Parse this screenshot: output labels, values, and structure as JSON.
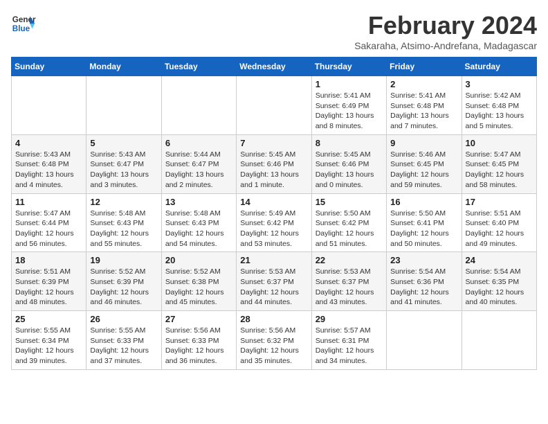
{
  "logo": {
    "line1": "General",
    "line2": "Blue"
  },
  "title": "February 2024",
  "subtitle": "Sakaraha, Atsimo-Andrefana, Madagascar",
  "days_of_week": [
    "Sunday",
    "Monday",
    "Tuesday",
    "Wednesday",
    "Thursday",
    "Friday",
    "Saturday"
  ],
  "weeks": [
    [
      {
        "day": "",
        "info": ""
      },
      {
        "day": "",
        "info": ""
      },
      {
        "day": "",
        "info": ""
      },
      {
        "day": "",
        "info": ""
      },
      {
        "day": "1",
        "info": "Sunrise: 5:41 AM\nSunset: 6:49 PM\nDaylight: 13 hours\nand 8 minutes."
      },
      {
        "day": "2",
        "info": "Sunrise: 5:41 AM\nSunset: 6:48 PM\nDaylight: 13 hours\nand 7 minutes."
      },
      {
        "day": "3",
        "info": "Sunrise: 5:42 AM\nSunset: 6:48 PM\nDaylight: 13 hours\nand 5 minutes."
      }
    ],
    [
      {
        "day": "4",
        "info": "Sunrise: 5:43 AM\nSunset: 6:48 PM\nDaylight: 13 hours\nand 4 minutes."
      },
      {
        "day": "5",
        "info": "Sunrise: 5:43 AM\nSunset: 6:47 PM\nDaylight: 13 hours\nand 3 minutes."
      },
      {
        "day": "6",
        "info": "Sunrise: 5:44 AM\nSunset: 6:47 PM\nDaylight: 13 hours\nand 2 minutes."
      },
      {
        "day": "7",
        "info": "Sunrise: 5:45 AM\nSunset: 6:46 PM\nDaylight: 13 hours\nand 1 minute."
      },
      {
        "day": "8",
        "info": "Sunrise: 5:45 AM\nSunset: 6:46 PM\nDaylight: 13 hours\nand 0 minutes."
      },
      {
        "day": "9",
        "info": "Sunrise: 5:46 AM\nSunset: 6:45 PM\nDaylight: 12 hours\nand 59 minutes."
      },
      {
        "day": "10",
        "info": "Sunrise: 5:47 AM\nSunset: 6:45 PM\nDaylight: 12 hours\nand 58 minutes."
      }
    ],
    [
      {
        "day": "11",
        "info": "Sunrise: 5:47 AM\nSunset: 6:44 PM\nDaylight: 12 hours\nand 56 minutes."
      },
      {
        "day": "12",
        "info": "Sunrise: 5:48 AM\nSunset: 6:43 PM\nDaylight: 12 hours\nand 55 minutes."
      },
      {
        "day": "13",
        "info": "Sunrise: 5:48 AM\nSunset: 6:43 PM\nDaylight: 12 hours\nand 54 minutes."
      },
      {
        "day": "14",
        "info": "Sunrise: 5:49 AM\nSunset: 6:42 PM\nDaylight: 12 hours\nand 53 minutes."
      },
      {
        "day": "15",
        "info": "Sunrise: 5:50 AM\nSunset: 6:42 PM\nDaylight: 12 hours\nand 51 minutes."
      },
      {
        "day": "16",
        "info": "Sunrise: 5:50 AM\nSunset: 6:41 PM\nDaylight: 12 hours\nand 50 minutes."
      },
      {
        "day": "17",
        "info": "Sunrise: 5:51 AM\nSunset: 6:40 PM\nDaylight: 12 hours\nand 49 minutes."
      }
    ],
    [
      {
        "day": "18",
        "info": "Sunrise: 5:51 AM\nSunset: 6:39 PM\nDaylight: 12 hours\nand 48 minutes."
      },
      {
        "day": "19",
        "info": "Sunrise: 5:52 AM\nSunset: 6:39 PM\nDaylight: 12 hours\nand 46 minutes."
      },
      {
        "day": "20",
        "info": "Sunrise: 5:52 AM\nSunset: 6:38 PM\nDaylight: 12 hours\nand 45 minutes."
      },
      {
        "day": "21",
        "info": "Sunrise: 5:53 AM\nSunset: 6:37 PM\nDaylight: 12 hours\nand 44 minutes."
      },
      {
        "day": "22",
        "info": "Sunrise: 5:53 AM\nSunset: 6:37 PM\nDaylight: 12 hours\nand 43 minutes."
      },
      {
        "day": "23",
        "info": "Sunrise: 5:54 AM\nSunset: 6:36 PM\nDaylight: 12 hours\nand 41 minutes."
      },
      {
        "day": "24",
        "info": "Sunrise: 5:54 AM\nSunset: 6:35 PM\nDaylight: 12 hours\nand 40 minutes."
      }
    ],
    [
      {
        "day": "25",
        "info": "Sunrise: 5:55 AM\nSunset: 6:34 PM\nDaylight: 12 hours\nand 39 minutes."
      },
      {
        "day": "26",
        "info": "Sunrise: 5:55 AM\nSunset: 6:33 PM\nDaylight: 12 hours\nand 37 minutes."
      },
      {
        "day": "27",
        "info": "Sunrise: 5:56 AM\nSunset: 6:33 PM\nDaylight: 12 hours\nand 36 minutes."
      },
      {
        "day": "28",
        "info": "Sunrise: 5:56 AM\nSunset: 6:32 PM\nDaylight: 12 hours\nand 35 minutes."
      },
      {
        "day": "29",
        "info": "Sunrise: 5:57 AM\nSunset: 6:31 PM\nDaylight: 12 hours\nand 34 minutes."
      },
      {
        "day": "",
        "info": ""
      },
      {
        "day": "",
        "info": ""
      }
    ]
  ]
}
